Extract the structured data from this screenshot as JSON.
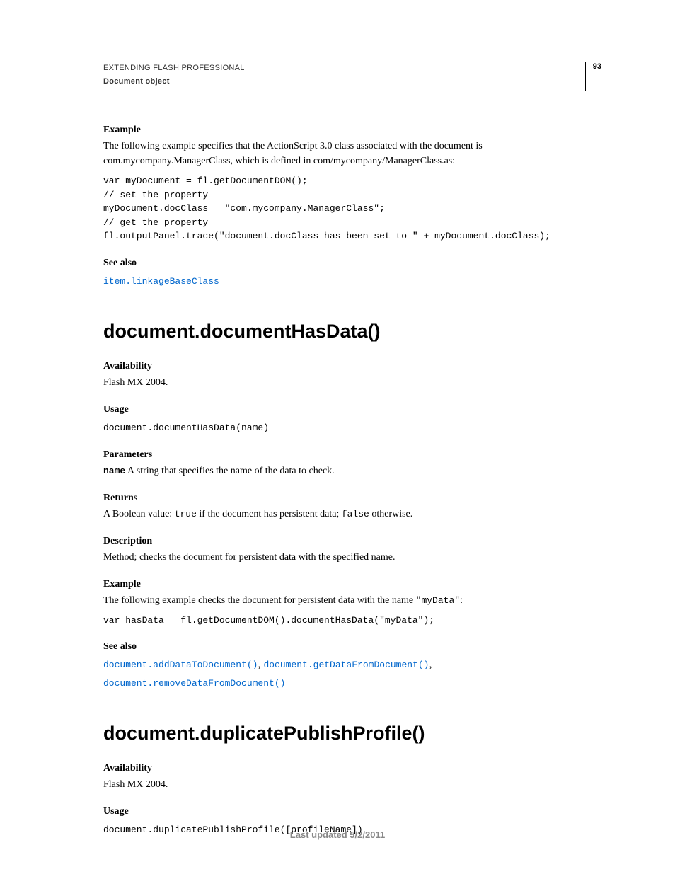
{
  "header": {
    "title": "EXTENDING FLASH PROFESSIONAL",
    "subtitle": "Document object",
    "pageNumber": "93"
  },
  "section1": {
    "exampleLabel": "Example",
    "exampleText": "The following example specifies that the ActionScript 3.0 class associated with the document is com.mycompany.ManagerClass, which is defined in com/mycompany/ManagerClass.as:",
    "code": "var myDocument = fl.getDocumentDOM();\n// set the property\nmyDocument.docClass = \"com.mycompany.ManagerClass\";\n// get the property\nfl.outputPanel.trace(\"document.docClass has been set to \" + myDocument.docClass);",
    "seeAlsoLabel": "See also",
    "seeAlsoLink": "item.linkageBaseClass"
  },
  "section2": {
    "heading": "document.documentHasData()",
    "availLabel": "Availability",
    "availText": "Flash MX 2004.",
    "usageLabel": "Usage",
    "usageCode": "document.documentHasData(name)",
    "paramsLabel": "Parameters",
    "paramName": "name",
    "paramDesc": "  A string that specifies the name of the data to check.",
    "returnsLabel": "Returns",
    "returnsPrefix": "A Boolean value: ",
    "returnsTrue": "true",
    "returnsMid": " if the document has persistent data; ",
    "returnsFalse": "false",
    "returnsSuffix": " otherwise.",
    "descLabel": "Description",
    "descText": "Method; checks the document for persistent data with the specified name.",
    "exampleLabel": "Example",
    "examplePrefix": "The following example checks the document for persistent data with the name ",
    "exampleCodeInline": "\"myData\"",
    "exampleSuffix": ":",
    "exampleCode": "var hasData = fl.getDocumentDOM().documentHasData(\"myData\");",
    "seeAlsoLabel": "See also",
    "seeAlso1": "document.addDataToDocument()",
    "seeAlso2": "document.getDataFromDocument()",
    "seeAlso3": "document.removeDataFromDocument()"
  },
  "section3": {
    "heading": "document.duplicatePublishProfile()",
    "availLabel": "Availability",
    "availText": "Flash MX 2004.",
    "usageLabel": "Usage",
    "usageCode": "document.duplicatePublishProfile([profileName])"
  },
  "footer": {
    "text": "Last updated 5/2/2011"
  }
}
